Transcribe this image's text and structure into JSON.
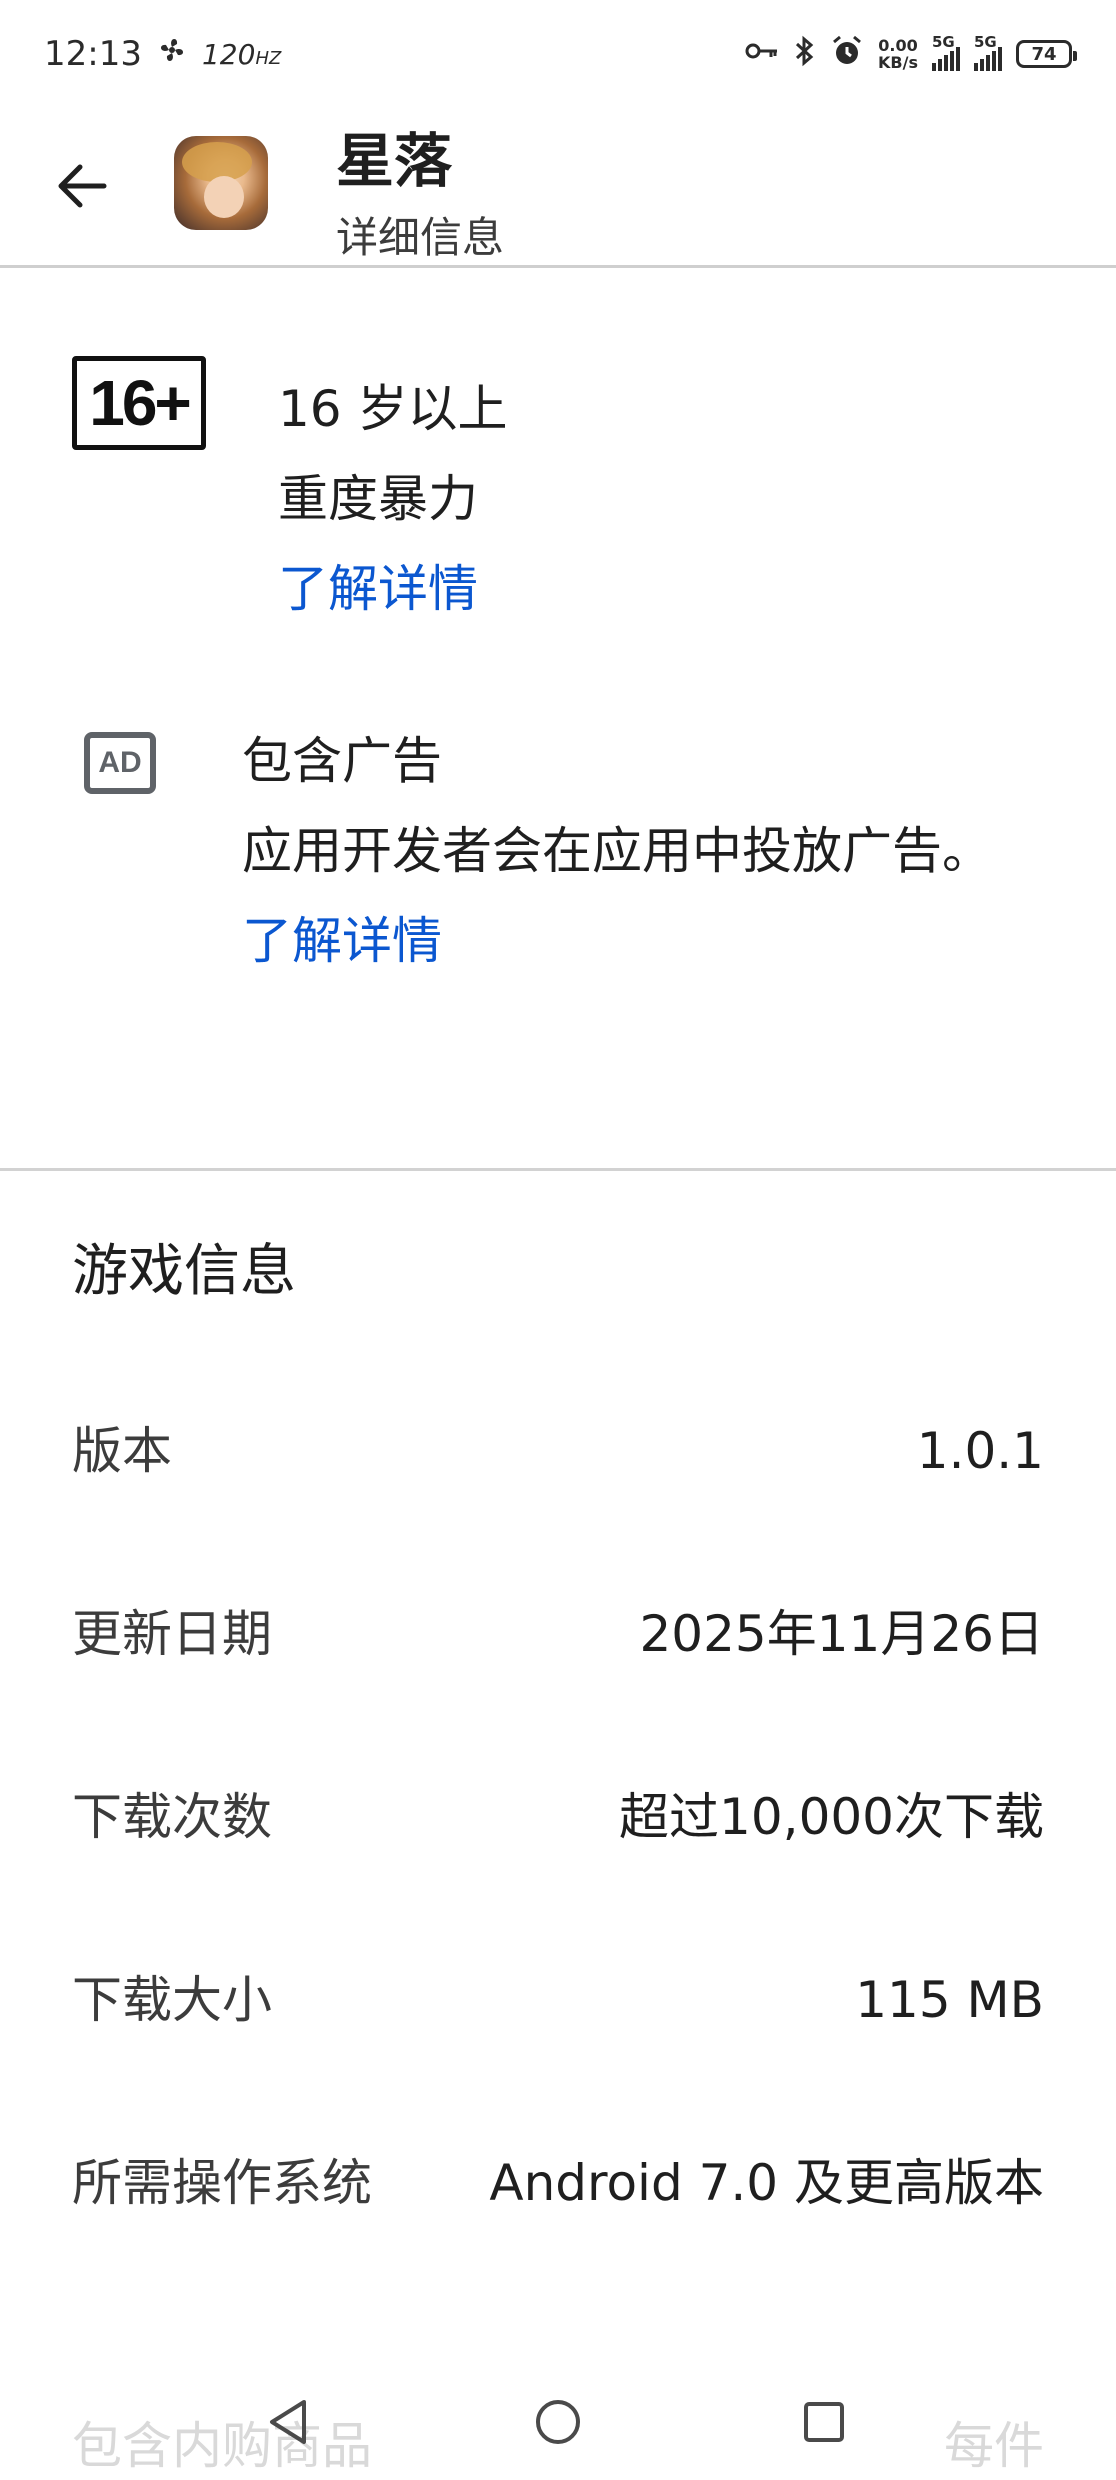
{
  "status_bar": {
    "time": "12:13",
    "refresh_rate": "120",
    "refresh_unit": "HZ",
    "net_speed_value": "0.00",
    "net_speed_unit": "KB/s",
    "signal1_label": "5G",
    "signal2_label": "5G",
    "battery": "74"
  },
  "header": {
    "app_name": "星落",
    "subtitle": "详细信息",
    "back_icon": "arrow-back-icon"
  },
  "content_rating": {
    "badge": "16+",
    "age": "16 岁以上",
    "descriptor": "重度暴力",
    "learn_more": "了解详情"
  },
  "ads": {
    "icon": "ad-icon",
    "icon_text": "AD",
    "title": "包含广告",
    "description": "应用开发者会在应用中投放广告。",
    "learn_more": "了解详情"
  },
  "game_info": {
    "title": "游戏信息",
    "rows": [
      {
        "label": "版本",
        "value": "1.0.1"
      },
      {
        "label": "更新日期",
        "value": "2025年11月26日"
      },
      {
        "label": "下载次数",
        "value": "超过10,000次下载"
      },
      {
        "label": "下载大小",
        "value": "115 MB"
      },
      {
        "label": "所需操作系统",
        "value": "Android 7.0 及更高版本"
      }
    ],
    "partial_row": {
      "label": "包含内购商品",
      "value": "每件"
    }
  },
  "colors": {
    "link": "#0b57d0",
    "divider": "#d2d2d2",
    "text": "#1f1f1f"
  }
}
